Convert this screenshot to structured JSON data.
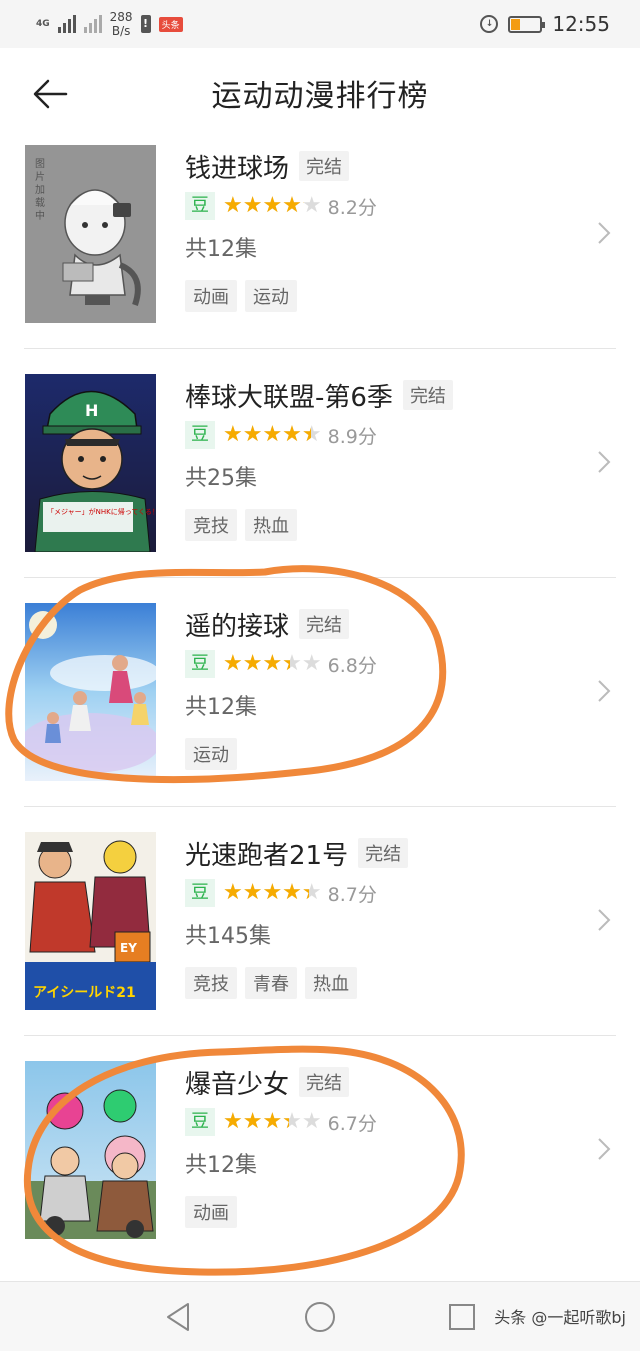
{
  "status_bar": {
    "network": "4G",
    "speed_value": "288",
    "speed_unit": "B/s",
    "app_badge": "头条",
    "time": "12:55"
  },
  "header": {
    "title": "运动动漫排行榜",
    "back_icon": "arrow-left-icon"
  },
  "items": [
    {
      "title": "钱进球场",
      "status": "完结",
      "douban_label": "豆",
      "rating": 8.2,
      "score_text": "8.2分",
      "episodes": "共12集",
      "tags": [
        "动画",
        "运动"
      ],
      "poster_caption": "图片加载中"
    },
    {
      "title": "棒球大联盟-第6季",
      "status": "完结",
      "douban_label": "豆",
      "rating": 8.9,
      "score_text": "8.9分",
      "episodes": "共25集",
      "tags": [
        "竞技",
        "热血"
      ],
      "poster_caption": "「メジャー」がNHKに帰ってくる！ 吾郎が「夢の舞台」メジャーリーグで、いよいよ激闘！"
    },
    {
      "title": "遥的接球",
      "status": "完结",
      "douban_label": "豆",
      "rating": 6.8,
      "score_text": "6.8分",
      "episodes": "共12集",
      "tags": [
        "运动"
      ],
      "poster_caption": ""
    },
    {
      "title": "光速跑者21号",
      "status": "完结",
      "douban_label": "豆",
      "rating": 8.7,
      "score_text": "8.7分",
      "episodes": "共145集",
      "tags": [
        "竞技",
        "青春",
        "热血"
      ],
      "poster_caption": "アイシールド21"
    },
    {
      "title": "爆音少女",
      "status": "完结",
      "douban_label": "豆",
      "rating": 6.7,
      "score_text": "6.7分",
      "episodes": "共12集",
      "tags": [
        "动画"
      ],
      "poster_caption": ""
    }
  ],
  "nav_bar": {
    "back_icon": "triangle-back-icon",
    "home_icon": "circle-home-icon",
    "recents_icon": "square-recents-icon"
  },
  "watermark": "头条 @一起听歌bj",
  "colors": {
    "star": "#f6ab00",
    "douban_green": "#2bb24c",
    "annotation": "#f0883a"
  }
}
